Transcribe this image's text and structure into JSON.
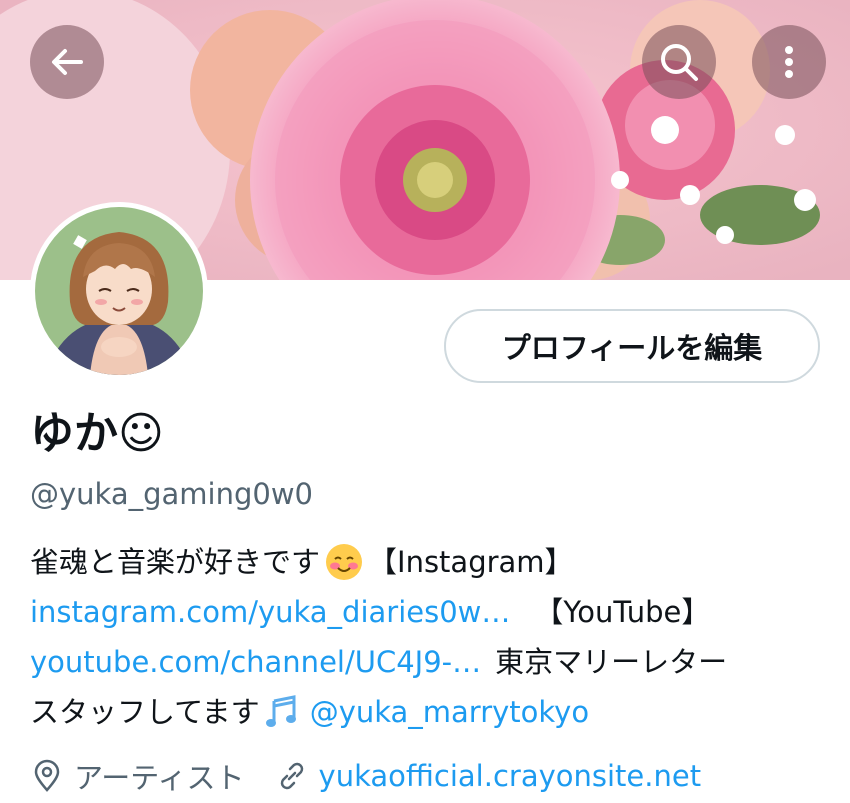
{
  "header": {
    "back_icon": "arrow-left-icon",
    "search_icon": "search-icon",
    "more_icon": "more-vertical-icon",
    "button_overlay_color": "#785A5A"
  },
  "profile": {
    "display_name": "ゆか☺",
    "handle": "@yuka_gaming0w0",
    "edit_button_label": "プロフィールを編集"
  },
  "bio": {
    "line1_text": "雀魂と音楽が好きです",
    "line1_emoji": "smiling-blush-emoji",
    "line1_tag": "【Instagram】",
    "instagram_link": "instagram.com/yuka_diaries0w…",
    "youtube_tag": "【YouTube】",
    "youtube_link": "youtube.com/channel/UC4J9-…",
    "line3_text": "東京マリーレター",
    "line4_text": "スタッフしてます",
    "line4_emoji": "musical-notes-emoji",
    "mention": "@yuka_marrytokyo"
  },
  "meta": {
    "location_icon": "location-pin-icon",
    "location": "アーティスト",
    "link_icon": "link-icon",
    "website": "yukaofficial.crayonsite.net"
  },
  "colors": {
    "link": "#1d9bf0",
    "secondary_text": "#536471",
    "primary_text": "#0f1419",
    "border": "#cfd9de"
  }
}
